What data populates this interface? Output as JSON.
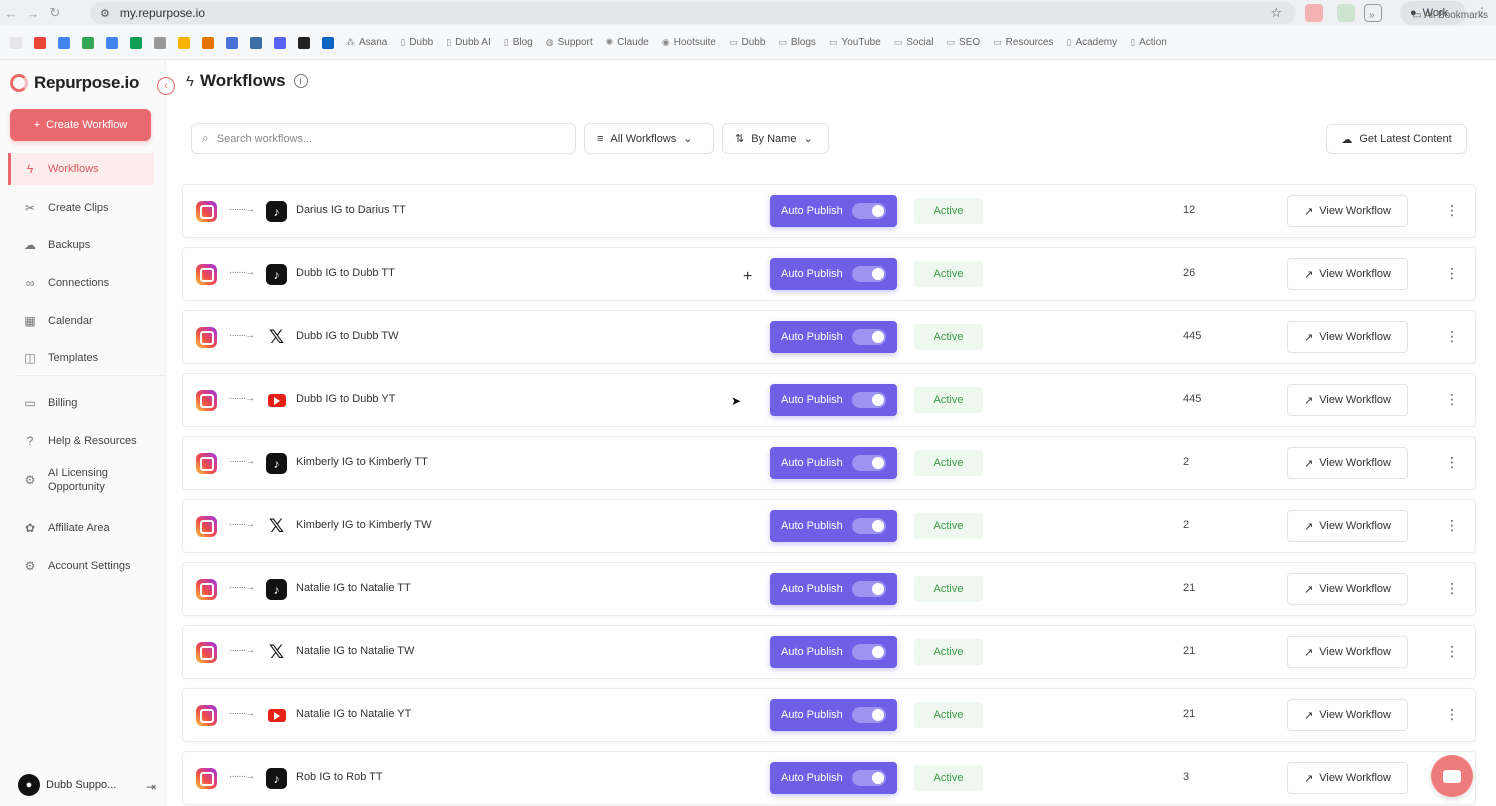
{
  "browser": {
    "url": "my.repurpose.io",
    "profile_label": "Work",
    "bookmarks": [
      "Asana",
      "Dubb",
      "Dubb AI",
      "Blog",
      "Support",
      "Claude",
      "Hootsuite",
      "Dubb",
      "Blogs",
      "YouTube",
      "Social",
      "SEO",
      "Resources",
      "Academy",
      "Action"
    ],
    "all_bookmarks_label": "All Bookmarks"
  },
  "sidebar": {
    "brand": "Repurpose.io",
    "create_label": "Create Workflow",
    "items": [
      {
        "label": "Workflows",
        "icon": "bolt-icon",
        "glyph": "ϟ",
        "active": true
      },
      {
        "label": "Create Clips",
        "icon": "scissors-icon",
        "glyph": "✂"
      },
      {
        "label": "Backups",
        "icon": "cloud-icon",
        "glyph": "☁"
      },
      {
        "label": "Connections",
        "icon": "link-icon",
        "glyph": "∞"
      },
      {
        "label": "Calendar",
        "icon": "calendar-icon",
        "glyph": "▦"
      },
      {
        "label": "Templates",
        "icon": "template-icon",
        "glyph": "◫"
      },
      {
        "label": "Billing",
        "icon": "billing-icon",
        "glyph": "▭"
      },
      {
        "label": "Help & Resources",
        "icon": "help-icon",
        "glyph": "?"
      },
      {
        "label": "AI Licensing Opportunity",
        "icon": "ai-icon",
        "glyph": "⚙"
      },
      {
        "label": "Affiliate Area",
        "icon": "affiliate-icon",
        "glyph": "✿"
      },
      {
        "label": "Account Settings",
        "icon": "settings-icon",
        "glyph": "⚙"
      }
    ],
    "user_name": "Dubb Suppo..."
  },
  "header": {
    "title": "Workflows"
  },
  "toolbar": {
    "search_placeholder": "Search workflows...",
    "filter_label": "All Workflows",
    "sort_label": "By Name",
    "latest_label": "Get Latest Content"
  },
  "workflows": [
    {
      "name": "Darius IG to Darius TT",
      "dest": "tiktok",
      "auto": "Auto Publish",
      "status": "Active",
      "count": "12",
      "view": "View Workflow"
    },
    {
      "name": "Dubb IG to Dubb TT",
      "dest": "tiktok",
      "auto": "Auto Publish",
      "status": "Active",
      "count": "26",
      "view": "View Workflow"
    },
    {
      "name": "Dubb IG to Dubb TW",
      "dest": "x",
      "auto": "Auto Publish",
      "status": "Active",
      "count": "445",
      "view": "View Workflow"
    },
    {
      "name": "Dubb IG to Dubb YT",
      "dest": "yt",
      "auto": "Auto Publish",
      "status": "Active",
      "count": "445",
      "view": "View Workflow"
    },
    {
      "name": "Kimberly IG to Kimberly TT",
      "dest": "tiktok",
      "auto": "Auto Publish",
      "status": "Active",
      "count": "2",
      "view": "View Workflow"
    },
    {
      "name": "Kimberly IG to Kimberly TW",
      "dest": "x",
      "auto": "Auto Publish",
      "status": "Active",
      "count": "2",
      "view": "View Workflow"
    },
    {
      "name": "Natalie IG to Natalie TT",
      "dest": "tiktok",
      "auto": "Auto Publish",
      "status": "Active",
      "count": "21",
      "view": "View Workflow"
    },
    {
      "name": "Natalie IG to Natalie TW",
      "dest": "x",
      "auto": "Auto Publish",
      "status": "Active",
      "count": "21",
      "view": "View Workflow"
    },
    {
      "name": "Natalie IG to Natalie YT",
      "dest": "yt",
      "auto": "Auto Publish",
      "status": "Active",
      "count": "21",
      "view": "View Workflow"
    },
    {
      "name": "Rob IG to Rob TT",
      "dest": "tiktok",
      "auto": "Auto Publish",
      "status": "Active",
      "count": "3",
      "view": "View Workflow"
    }
  ],
  "colors": {
    "accent": "#e96a6e",
    "auto_publish": "#6f5ee6",
    "status_active": "#3d9a49"
  }
}
